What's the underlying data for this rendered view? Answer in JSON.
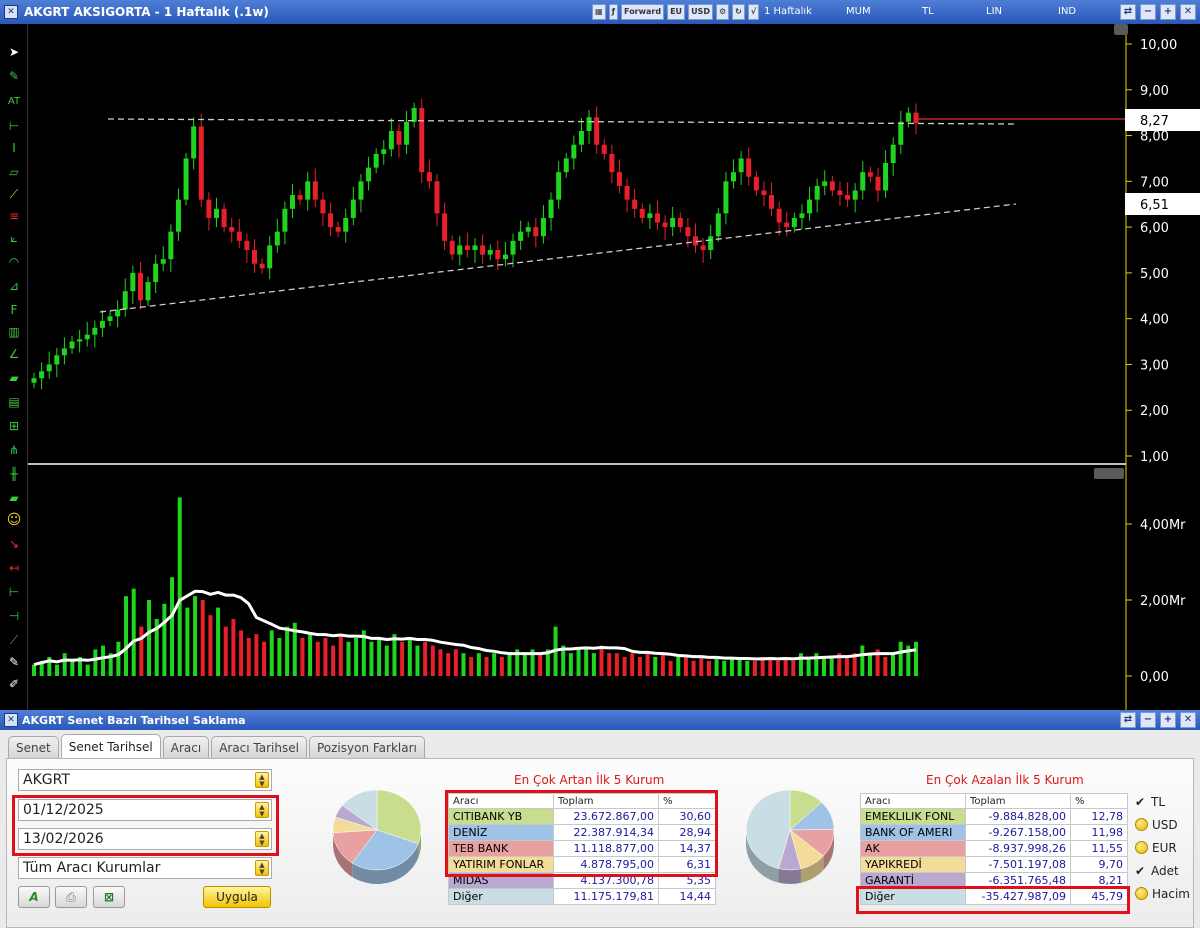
{
  "window": {
    "title": "AKGRT AKSIGORTA - 1 Haftalık (.1w)",
    "period": "1 Haftalık",
    "chart_style": "MUM",
    "currency": "TL",
    "scale": "LIN",
    "mode": "IND"
  },
  "toolbar_icons": [
    "Forward",
    "EU",
    "USD"
  ],
  "price_labels": {
    "current": "8,27",
    "support": "6,51"
  },
  "chart_data": [
    {
      "type": "candlestick",
      "title": "",
      "ylim": [
        1.0,
        10.0
      ],
      "yticks": [
        "10,00",
        "9,00",
        "8,00",
        "7,00",
        "6,00",
        "5,00",
        "4,00",
        "3,00",
        "2,00",
        "1,00"
      ],
      "colors": {
        "up": "#1fd51f",
        "down": "#e8202a",
        "bg": "#000000",
        "axis": "#f0d000"
      },
      "annotations": [
        "horizontal dashed resistance ~8.35",
        "ascending dashed trendline ~4.15 to ~6.5",
        "red horizontal line at 8.27"
      ],
      "ohlc_close": [
        2.7,
        2.85,
        3.0,
        3.2,
        3.35,
        3.5,
        3.55,
        3.65,
        3.8,
        3.95,
        4.05,
        4.2,
        4.6,
        5.0,
        4.4,
        4.8,
        5.2,
        5.3,
        5.9,
        6.6,
        7.5,
        8.2,
        6.6,
        6.2,
        6.4,
        6.0,
        5.9,
        5.7,
        5.5,
        5.2,
        5.1,
        5.6,
        5.9,
        6.4,
        6.7,
        6.6,
        7.0,
        6.6,
        6.3,
        6.0,
        5.9,
        6.2,
        6.6,
        7.0,
        7.3,
        7.6,
        7.7,
        8.1,
        7.8,
        8.3,
        8.6,
        7.2,
        7.0,
        6.3,
        5.7,
        5.4,
        5.6,
        5.5,
        5.6,
        5.4,
        5.5,
        5.3,
        5.4,
        5.7,
        5.9,
        6.0,
        5.8,
        6.2,
        6.6,
        7.2,
        7.5,
        7.8,
        8.1,
        8.4,
        7.8,
        7.6,
        7.2,
        6.9,
        6.6,
        6.4,
        6.2,
        6.3,
        6.1,
        6.0,
        6.2,
        6.0,
        5.8,
        5.6,
        5.5,
        5.8,
        6.3,
        7.0,
        7.2,
        7.5,
        7.1,
        6.8,
        6.7,
        6.4,
        6.1,
        6.0,
        6.2,
        6.3,
        6.6,
        6.9,
        7.0,
        6.8,
        6.7,
        6.6,
        6.8,
        7.2,
        7.1,
        6.8,
        7.4,
        7.8,
        8.3,
        8.5,
        8.27
      ]
    },
    {
      "type": "bar",
      "title": "",
      "ylim": [
        0,
        5000000
      ],
      "yticks": [
        "4,00Mr",
        "2,00Mr",
        "0,00"
      ],
      "colors": {
        "up": "#1fd51f",
        "down": "#e8202a",
        "ma": "#ffffff"
      },
      "values_mr": [
        0.3,
        0.4,
        0.5,
        0.3,
        0.6,
        0.4,
        0.5,
        0.3,
        0.7,
        0.8,
        0.6,
        0.9,
        2.1,
        2.3,
        1.3,
        2.0,
        1.5,
        1.9,
        2.6,
        4.7,
        1.8,
        2.1,
        2.0,
        1.6,
        1.8,
        1.3,
        1.5,
        1.2,
        1.0,
        1.1,
        0.9,
        1.2,
        1.0,
        1.3,
        1.4,
        1.0,
        1.1,
        0.9,
        1.0,
        0.8,
        1.1,
        0.9,
        1.0,
        1.2,
        0.9,
        1.0,
        0.8,
        1.1,
        0.9,
        1.0,
        0.8,
        0.9,
        0.8,
        0.7,
        0.6,
        0.7,
        0.6,
        0.5,
        0.6,
        0.5,
        0.6,
        0.5,
        0.6,
        0.7,
        0.6,
        0.7,
        0.6,
        0.7,
        1.3,
        0.8,
        0.6,
        0.7,
        0.7,
        0.6,
        0.8,
        0.6,
        0.6,
        0.5,
        0.6,
        0.5,
        0.6,
        0.5,
        0.6,
        0.4,
        0.5,
        0.5,
        0.4,
        0.5,
        0.4,
        0.5,
        0.4,
        0.5,
        0.5,
        0.4,
        0.4,
        0.5,
        0.5,
        0.4,
        0.5,
        0.4,
        0.6,
        0.5,
        0.6,
        0.5,
        0.5,
        0.6,
        0.5,
        0.6,
        0.8,
        0.6,
        0.7,
        0.5,
        0.6,
        0.9,
        0.8,
        0.9
      ]
    }
  ],
  "panel": {
    "title": "AKGRT Senet Bazlı Tarihsel Saklama",
    "tabs": [
      "Senet",
      "Senet Tarihsel",
      "Aracı",
      "Aracı Tarihsel",
      "Pozisyon Farkları"
    ],
    "symbol": "AKGRT",
    "date_from": "01/12/2025",
    "date_to": "13/02/2026",
    "filter": "Tüm Aracı Kurumlar",
    "apply": "Uygula"
  },
  "increase_table": {
    "title": "En Çok Artan İlk 5 Kurum",
    "headers": [
      "Aracı",
      "Toplam",
      "%"
    ],
    "rows": [
      {
        "name": "CITIBANK YB",
        "total": "23.672.867,00",
        "pct": "30,60",
        "color": "#c9dd8e"
      },
      {
        "name": "DENİZ",
        "total": "22.387.914,34",
        "pct": "28,94",
        "color": "#9fc3e6"
      },
      {
        "name": "TEB BANK",
        "total": "11.118.877,00",
        "pct": "14,37",
        "color": "#e8a0a0"
      },
      {
        "name": "YATIRIM FONLAR",
        "total": "4.878.795,00",
        "pct": "6,31",
        "color": "#f3dc9a"
      },
      {
        "name": "MIDAS",
        "total": "4.137.300,78",
        "pct": "5,35",
        "color": "#b9a8cf"
      },
      {
        "name": "Diğer",
        "total": "11.175.179,81",
        "pct": "14,44",
        "color": "#c8dde4"
      }
    ]
  },
  "decrease_table": {
    "title": "En Çok Azalan İlk 5 Kurum",
    "headers": [
      "Aracı",
      "Toplam",
      "%"
    ],
    "rows": [
      {
        "name": "EMEKLILIK FONL",
        "total": "-9.884.828,00",
        "pct": "12,78",
        "color": "#c9dd8e"
      },
      {
        "name": "BANK OF AMERI",
        "total": "-9.267.158,00",
        "pct": "11,98",
        "color": "#9fc3e6"
      },
      {
        "name": "AK",
        "total": "-8.937.998,26",
        "pct": "11,55",
        "color": "#e8a0a0"
      },
      {
        "name": "YAPIKREDİ",
        "total": "-7.501.197,08",
        "pct": "9,70",
        "color": "#f3dc9a"
      },
      {
        "name": "GARANTİ",
        "total": "-6.351.765,48",
        "pct": "8,21",
        "color": "#b9a8cf"
      },
      {
        "name": "Diğer",
        "total": "-35.427.987,09",
        "pct": "45,79",
        "color": "#c8dde4"
      }
    ]
  },
  "options": [
    {
      "label": "TL",
      "checked": true
    },
    {
      "label": "USD",
      "checked": false
    },
    {
      "label": "EUR",
      "checked": false
    },
    {
      "label": "Adet",
      "checked": true
    },
    {
      "label": "Hacim",
      "checked": false
    }
  ]
}
